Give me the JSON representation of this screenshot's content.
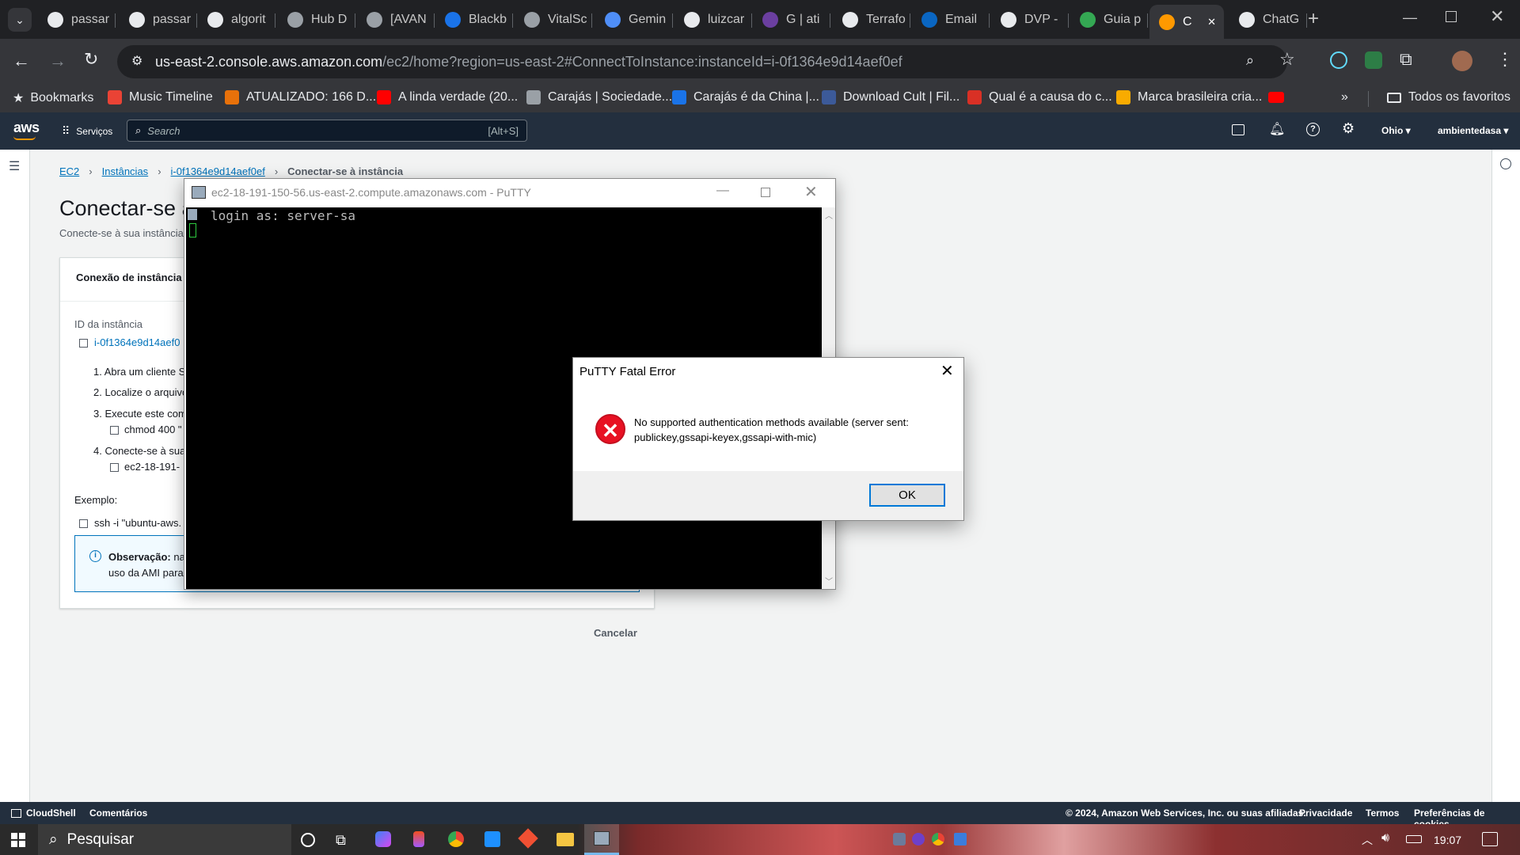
{
  "browser": {
    "tabs": [
      {
        "label": "passar",
        "color": "#e8eaed"
      },
      {
        "label": "passar",
        "color": "#e8eaed"
      },
      {
        "label": "algorit",
        "color": "#e8eaed"
      },
      {
        "label": "Hub D",
        "color": "#9aa0a6"
      },
      {
        "label": "[AVAN",
        "color": "#9aa0a6"
      },
      {
        "label": "Blackb",
        "color": "#1a73e8"
      },
      {
        "label": "VitalSc",
        "color": "#9aa0a6"
      },
      {
        "label": "Gemin",
        "color": "#4f8ef7"
      },
      {
        "label": "luizcar",
        "color": "#e8eaed"
      },
      {
        "label": "G | ati",
        "color": "#6b3fa0"
      },
      {
        "label": "Terrafo",
        "color": "#e8eaed"
      },
      {
        "label": "Email",
        "color": "#0a66c2"
      },
      {
        "label": "DVP -",
        "color": "#e8eaed"
      },
      {
        "label": "Guia p",
        "color": "#34a853"
      },
      {
        "label": "C",
        "color": "#ff9900"
      },
      {
        "label": "ChatG",
        "color": "#e8eaed"
      }
    ],
    "url_domain": "us-east-2.console.aws.amazon.com",
    "url_path": "/ec2/home?region=us-east-2#ConnectToInstance:instanceId=i-0f1364e9d14aef0ef",
    "bookmarks_label": "Bookmarks",
    "bookmarks": [
      {
        "label": "Music Timeline",
        "color": "#ea4335"
      },
      {
        "label": "ATUALIZADO: 166 D...",
        "color": "#e8710a"
      },
      {
        "label": "A linda verdade (20...",
        "color": "#ff0000"
      },
      {
        "label": "Carajás | Sociedade...",
        "color": "#9aa0a6"
      },
      {
        "label": "Carajás é da China |...",
        "color": "#1a73e8"
      },
      {
        "label": "Download Cult | Fil...",
        "color": "#3c5a99"
      },
      {
        "label": "Qual é a causa do c...",
        "color": "#d93025"
      },
      {
        "label": "Marca brasileira cria...",
        "color": "#f9ab00"
      }
    ],
    "all_bookmarks": "Todos os favoritos"
  },
  "aws": {
    "logo": "aws",
    "services": "Serviços",
    "search_placeholder": "Search",
    "search_shortcut": "[Alt+S]",
    "region": "Ohio ▾",
    "account": "ambientedasa ▾",
    "breadcrumb": [
      "EC2",
      "Instâncias",
      "i-0f1364e9d14aef0ef",
      "Conectar-se à instância"
    ],
    "page_title": "Conectar-se à",
    "page_subtitle": "Conecte-se à sua instância",
    "panel_heading": "Conexão de instância c",
    "instance_id_label": "ID da instância",
    "instance_id_value": "i-0f1364e9d14aef0",
    "steps": [
      "1. Abra um cliente S",
      "2. Localize o arquivo",
      "3. Execute este com",
      "4. Conecte-se à sua"
    ],
    "step3_cmd": "chmod 400 \"",
    "step4_cmd": "ec2-18-191-",
    "example_label": "Exemplo:",
    "example_cmd": "ssh -i \"ubuntu-aws.",
    "note_bold": "Observação:",
    "note_text1": "na",
    "note_text2": "uso da AMI para",
    "cancel": "Cancelar",
    "footer": {
      "cloudshell": "CloudShell",
      "comments": "Comentários",
      "copyright": "© 2024, Amazon Web Services, Inc. ou suas afiliadas.",
      "privacy": "Privacidade",
      "terms": "Termos",
      "cookies": "Preferências de cookies"
    }
  },
  "putty": {
    "title": "ec2-18-191-150-56.us-east-2.compute.amazonaws.com - PuTTY",
    "terminal_line": "login as: server-sa"
  },
  "dialog": {
    "title": "PuTTY Fatal Error",
    "message1": "No supported authentication methods available (server sent:",
    "message2": "publickey,gssapi-keyex,gssapi-with-mic)",
    "ok": "OK"
  },
  "taskbar": {
    "search": "Pesquisar",
    "time": "19:07"
  }
}
